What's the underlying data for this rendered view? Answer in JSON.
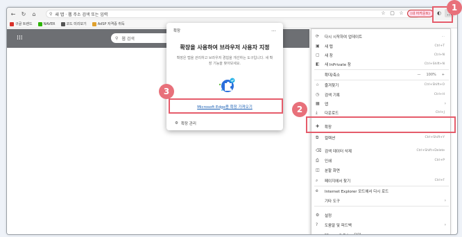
{
  "toolbar": {
    "url": "새 탭 ‧ 웹 주소 검색 또는 입력",
    "profile_label": "(내 어카운트)",
    "more_glyph": "…"
  },
  "bookmarks": [
    {
      "label": "구글 트렌드",
      "color": "#d9322b"
    },
    {
      "label": "NAVER",
      "color": "#2db400"
    },
    {
      "label": "코드 미리보기",
      "color": "#555555"
    },
    {
      "label": "AdSP 자격증 취득",
      "color": "#e0a12d"
    }
  ],
  "ntp": {
    "search_placeholder": "웹 검색"
  },
  "popup": {
    "header": "확장",
    "more_glyph": "…",
    "title": "확장을 사용하여 브라우저 사용자 지정",
    "description": "확장은 탭을 관리하고 브라우저 경험을 개선하는 도구입니다. 새 확장 기능을 찾아보세요.",
    "link": "Microsoft Edge용 확장 가져오기",
    "manage": "확장 관리"
  },
  "menu": {
    "items": [
      {
        "label": "다시 시작하여 업데이트",
        "shortcut": "…",
        "icon": "update-icon"
      },
      {
        "label": "새 탭",
        "shortcut": "Ctrl+T",
        "icon": "new-tab-icon"
      },
      {
        "label": "새 창",
        "shortcut": "Ctrl+N",
        "icon": "new-window-icon"
      },
      {
        "label": "새 InPrivate 창",
        "shortcut": "Ctrl+Shift+N",
        "icon": "inprivate-icon"
      },
      {
        "label": "확대/축소",
        "shortcut": "",
        "icon": "zoom-icon"
      },
      {
        "label": "즐겨찾기",
        "shortcut": "Ctrl+Shift+O",
        "icon": "favorites-icon"
      },
      {
        "label": "검색 기록",
        "shortcut": "Ctrl+H",
        "icon": "history-icon"
      },
      {
        "label": "앱",
        "shortcut": "",
        "icon": "apps-icon"
      },
      {
        "label": "다운로드",
        "shortcut": "Ctrl+J",
        "icon": "downloads-icon"
      },
      {
        "label": "확장",
        "shortcut": "",
        "icon": "extensions-icon"
      },
      {
        "label": "컬렉션",
        "shortcut": "Ctrl+Shift+Y",
        "icon": "collections-icon"
      },
      {
        "label": "검색 데이터 삭제",
        "shortcut": "Ctrl+Shift+Delete",
        "icon": "clear-data-icon"
      },
      {
        "label": "인쇄",
        "shortcut": "Ctrl+P",
        "icon": "print-icon"
      },
      {
        "label": "분할 화면",
        "shortcut": "",
        "icon": "split-screen-icon"
      },
      {
        "label": "페이지에서 찾기",
        "shortcut": "Ctrl+F",
        "icon": "find-icon"
      },
      {
        "label": "Internet Explorer 모드에서 다시 로드",
        "shortcut": "",
        "icon": "ie-mode-icon"
      },
      {
        "label": "기타 도구",
        "shortcut": "",
        "icon": "more-tools-icon"
      },
      {
        "label": "설정",
        "shortcut": "",
        "icon": "settings-icon"
      },
      {
        "label": "도움말 및 피드백",
        "shortcut": "",
        "icon": "help-icon"
      },
      {
        "label": "Microsoft Edge 닫기",
        "shortcut": "",
        "icon": "close-edge-icon"
      }
    ],
    "zoom_value": "100%",
    "zoom_minus": "—",
    "zoom_plus": "+"
  },
  "annotations": {
    "badge1": "1",
    "badge2": "2",
    "badge3": "3",
    "accent_color": "#e8707a"
  }
}
